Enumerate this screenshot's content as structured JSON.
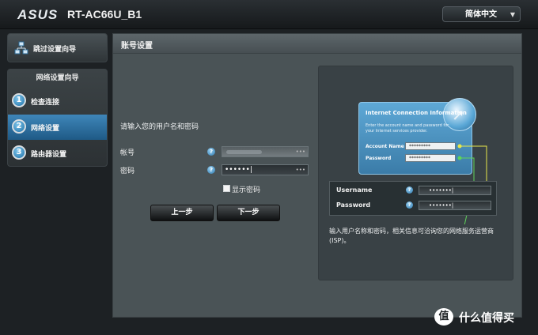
{
  "header": {
    "logo": "ASUS",
    "model": "RT-AC66U_B1",
    "language": "简体中文",
    "language_caret": "▼"
  },
  "sidebar": {
    "quick_setup": "跳过设置向导",
    "wizard_title": "网络设置向导",
    "steps": [
      {
        "num": "1",
        "label": "检查连接"
      },
      {
        "num": "2",
        "label": "网络设置"
      },
      {
        "num": "3",
        "label": "路由器设置"
      }
    ]
  },
  "main": {
    "title": "账号设置",
    "prompt": "请输入您的用户名和密码",
    "account_label": "帐号",
    "password_label": "密码",
    "help_glyph": "?",
    "password_value": "••••••|",
    "field_key_glyph": "•••",
    "show_password": "显示密码",
    "prev_button": "上一步",
    "next_button": "下一步"
  },
  "illustration": {
    "card_title": "Internet Connection Information",
    "card_desc": "Enter the account name and password for your Internet services provider.",
    "account_name_label": "Account Name",
    "account_name_value": "*********",
    "password_label": "Password",
    "password_value": "*********",
    "username_label": "Username",
    "username_value": "•••••••|",
    "password_label2": "Password",
    "password_value2": "•••••••|",
    "note": "输入用户名称和密码，相关信息可洽询您的网络服务运营商 (ISP)。"
  },
  "watermark": {
    "badge": "值",
    "text": "什么值得买"
  },
  "colors": {
    "accent_active": "#3f86b9",
    "connector_yellow": "#e8e84a",
    "connector_green": "#5fd35a"
  }
}
